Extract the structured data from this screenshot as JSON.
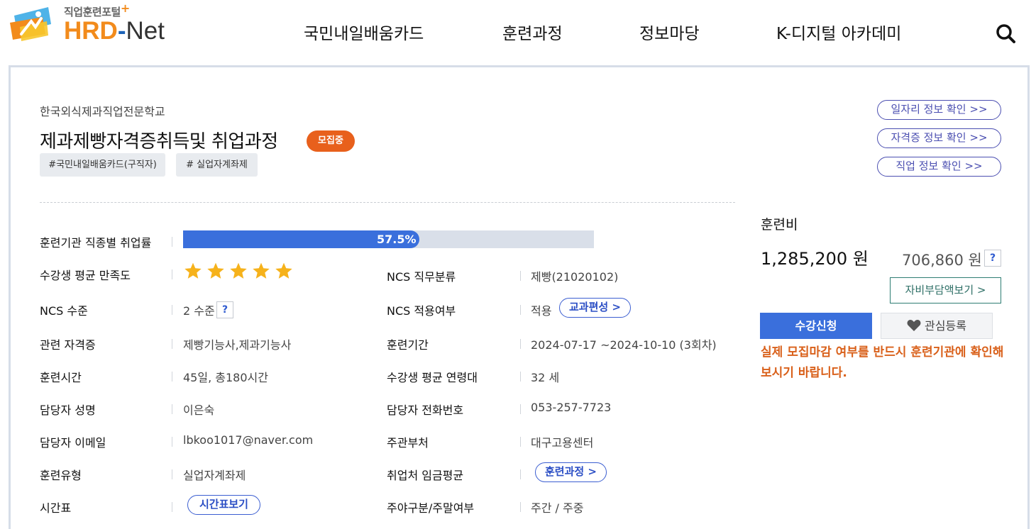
{
  "header": {
    "logo_sub": "직업훈련포털",
    "logo_plus": "+",
    "logo_hrd": "HRD",
    "logo_dash": "-",
    "logo_net": "Net",
    "nav": [
      "국민내일배움카드",
      "훈련과정",
      "정보마당",
      "K-디지털 아카데미"
    ]
  },
  "course": {
    "org": "한국외식제과직업전문학교",
    "title": "제과제빵자격증취득및 취업과정",
    "status": "모집중",
    "tags": [
      "#국민내일배움카드(구직자)",
      "# 실업자계좌제"
    ]
  },
  "links": [
    "일자리 정보 확인 >>",
    "자격증 정보 확인 >>",
    "직업 정보 확인 >>"
  ],
  "employment": {
    "label": "훈련기관 직종별 취업률",
    "rate_text": "57.5%",
    "rate": 57.5
  },
  "satisfaction": {
    "label": "수강생 평균 만족도",
    "stars": 5,
    "star_color": "#f6b21b"
  },
  "rows_left": [
    {
      "label": "NCS 수준",
      "value": "2 수준"
    },
    {
      "label": "관련 자격증",
      "value": "제빵기능사,제과기능사"
    },
    {
      "label": "훈련시간",
      "value": "45일, 총180시간"
    },
    {
      "label": "담당자 성명",
      "value": "이은숙"
    },
    {
      "label": "담당자 이메일",
      "value": "lbkoo1017@naver.com"
    },
    {
      "label": "훈련유형",
      "value": "실업자계좌제"
    },
    {
      "label": "시간표",
      "value": ""
    }
  ],
  "rows_right": [
    {
      "label": "NCS 직무분류",
      "value": "제빵(21020102)"
    },
    {
      "label": "NCS 적용여부",
      "value": "적용"
    },
    {
      "label": "훈련기간",
      "value": "2024-07-17 ~2024-10-10 (3회차)"
    },
    {
      "label": "수강생 평균 연령대",
      "value": "32 세"
    },
    {
      "label": "담당자 전화번호",
      "value": "053-257-7723"
    },
    {
      "label": "주관부처",
      "value": "대구고용센터"
    },
    {
      "label": "취업처 임금평균",
      "value": ""
    },
    {
      "label": "주야구분/주말여부",
      "value": "주간 / 주중"
    }
  ],
  "buttons": {
    "help": "?",
    "curriculum": "교과편성 >",
    "course_link": "훈련과정 >",
    "timetable": "시간표보기"
  },
  "fee": {
    "title": "훈련비",
    "total": "1,285,200 원",
    "self": "706,860 원",
    "self_btn": "자비부담액보기 >",
    "apply": "수강신청",
    "wish": "관심등록",
    "notice": "실제 모집마감 여부를 반드시 훈련기관에 확인해보시기 바랍니다."
  },
  "colors": {
    "accent": "#3a6fdc",
    "status": "#e8601c",
    "notice": "#d9601a",
    "logo_orange": "#f28b1c"
  }
}
